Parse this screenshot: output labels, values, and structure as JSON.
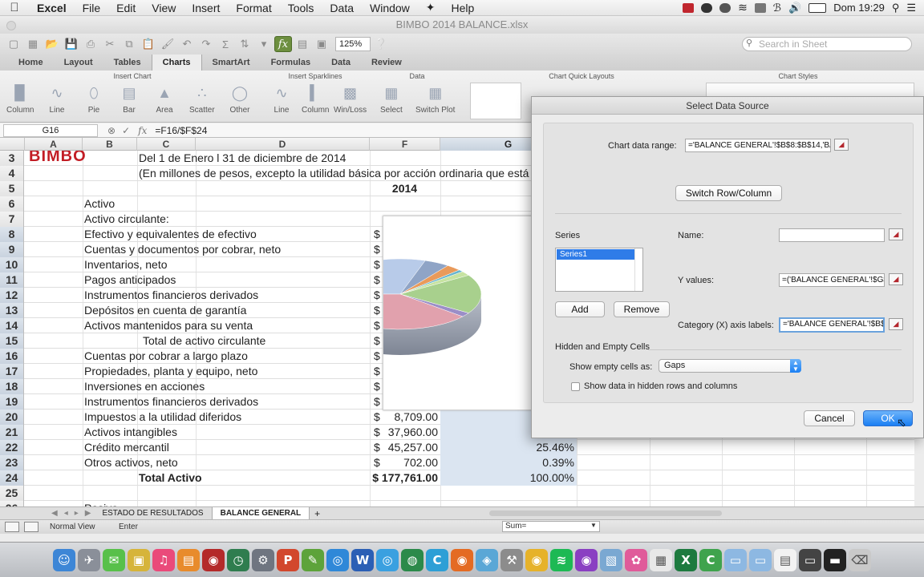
{
  "menubar": {
    "app": "Excel",
    "items": [
      "File",
      "Edit",
      "View",
      "Insert",
      "Format",
      "Tools",
      "Data",
      "Window",
      "Help"
    ],
    "clock": "Dom 19:29"
  },
  "window": {
    "title": "BIMBO 2014 BALANCE.xlsx"
  },
  "toolbar": {
    "zoom": "125%",
    "search_placeholder": "Search in Sheet"
  },
  "ribbon": {
    "tabs": [
      "Home",
      "Layout",
      "Tables",
      "Charts",
      "SmartArt",
      "Formulas",
      "Data",
      "Review"
    ],
    "active_tab": "Charts",
    "groups": {
      "insert_chart": "Insert Chart",
      "insert_sparklines": "Insert Sparklines",
      "data": "Data",
      "quick_layouts": "Chart Quick Layouts",
      "chart_styles": "Chart Styles"
    },
    "chart_buttons": [
      "Column",
      "Line",
      "Pie",
      "Bar",
      "Area",
      "Scatter",
      "Other"
    ],
    "sparkline_buttons": [
      "Line",
      "Column",
      "Win/Loss"
    ],
    "data_buttons": [
      "Select",
      "Switch Plot"
    ]
  },
  "formula_bar": {
    "cell": "G16",
    "fx": "fx",
    "formula": "=F16/$F$24"
  },
  "columns": [
    "A",
    "B",
    "C",
    "D",
    "F",
    "G"
  ],
  "rows": [
    {
      "n": "3",
      "b": "",
      "c": "Del 1 de Enero l 31 de diciembre de 2014",
      "f": "",
      "g": ""
    },
    {
      "n": "4",
      "b": "",
      "c": "(En millones de pesos, excepto la utilidad básica por acción ordinaria que está expres",
      "f": "",
      "g": ""
    },
    {
      "n": "5",
      "b": "",
      "c": "",
      "f": "2014",
      "g": ""
    },
    {
      "n": "6",
      "b": "Activo",
      "c": "",
      "f": "",
      "g": ""
    },
    {
      "n": "7",
      "b": "Activo circulante:",
      "c": "",
      "f": "",
      "g": ""
    },
    {
      "n": "8",
      "b": " Efectivo y equivalentes de efectivo",
      "c": "",
      "f": "$",
      "g": ""
    },
    {
      "n": "9",
      "b": " Cuentas y documentos por cobrar, neto",
      "c": "",
      "f": "$",
      "g": ""
    },
    {
      "n": "10",
      "b": " Inventarios, neto",
      "c": "",
      "f": "$",
      "g": ""
    },
    {
      "n": "11",
      "b": " Pagos anticipados",
      "c": "",
      "f": "$",
      "g": ""
    },
    {
      "n": "12",
      "b": " Instrumentos financieros derivados",
      "c": "",
      "f": "$",
      "g": ""
    },
    {
      "n": "13",
      "b": " Depósitos en cuenta de garantía",
      "c": "",
      "f": "$",
      "g": ""
    },
    {
      "n": "14",
      "b": " Activos mantenidos para su venta",
      "c": "",
      "f": "$",
      "g": ""
    },
    {
      "n": "15",
      "b": "",
      "c": "Total de activo circulante",
      "f": "$",
      "g": ""
    },
    {
      "n": "16",
      "b": " Cuentas por cobrar a largo plazo",
      "c": "",
      "f": "$",
      "g": ""
    },
    {
      "n": "17",
      "b": " Propiedades, planta y equipo, neto",
      "c": "",
      "f": "$",
      "g": ""
    },
    {
      "n": "18",
      "b": " Inversiones en acciones",
      "c": "",
      "f": "$",
      "g": ""
    },
    {
      "n": "19",
      "b": " Instrumentos financieros derivados",
      "c": "",
      "f": "$",
      "g": ""
    },
    {
      "n": "20",
      "b": " Impuestos a la utilidad diferidos",
      "c": "",
      "f": "$",
      "fv": "8,709.00",
      "g": ""
    },
    {
      "n": "21",
      "b": " Activos intangibles",
      "c": "",
      "f": "$",
      "fv": "37,960.00",
      "g": ""
    },
    {
      "n": "22",
      "b": " Crédito mercantil",
      "c": "",
      "f": "$",
      "fv": "45,257.00",
      "g": "25.46%"
    },
    {
      "n": "23",
      "b": " Otros activos, neto",
      "c": "",
      "f": "$",
      "fv": "702.00",
      "g": "0.39%"
    },
    {
      "n": "24",
      "b": "",
      "c": "Total Activo",
      "f": "$ 177,761.00",
      "g": "100.00%"
    },
    {
      "n": "25",
      "b": "",
      "c": "",
      "f": "",
      "g": ""
    },
    {
      "n": "26",
      "b": "Pasivo",
      "c": "",
      "f": "",
      "g": ""
    }
  ],
  "logo_text": "BIMBO",
  "sheet_tabs": [
    "ESTADO DE RESULTADOS",
    "BALANCE GENERAL"
  ],
  "active_sheet": "BALANCE GENERAL",
  "status": {
    "view": "Normal View",
    "mode": "Enter",
    "sum": "Sum="
  },
  "dialog": {
    "title": "Select Data Source",
    "chart_range_label": "Chart data range:",
    "chart_range_value": "='BALANCE GENERAL'!$B$8:$B$14,'BA",
    "switch_button": "Switch Row/Column",
    "series_label": "Series",
    "series_items": [
      "Series1"
    ],
    "name_label": "Name:",
    "name_value": "",
    "y_values_label": "Y values:",
    "y_values_value": "=('BALANCE GENERAL'!$G$",
    "category_label": "Category (X) axis labels:",
    "category_value": "='BALANCE GENERAL'!$B$8",
    "add_button": "Add",
    "remove_button": "Remove",
    "hidden_empty_label": "Hidden and Empty Cells",
    "show_empty_label": "Show empty cells as:",
    "show_empty_value": "Gaps",
    "hidden_rows_label": "Show data in hidden rows and columns",
    "cancel_button": "Cancel",
    "ok_button": "OK"
  },
  "colors": {
    "selection": "#dbe5f1",
    "primary_button": "#1b7ff3",
    "active_tab": "#ececec",
    "pie": [
      "#b8cbe9",
      "#8fa4c6",
      "#e99a5a",
      "#67b6cf",
      "#c7e3a1",
      "#a8d08d",
      "#9b8ec7",
      "#e1a1ad"
    ]
  },
  "dock_icons": [
    "finder-icon",
    "launchpad-icon",
    "messages-icon",
    "notes-icon",
    "itunes-icon",
    "ibooks-icon",
    "photobooth-icon",
    "time-machine-icon",
    "system-prefs-icon",
    "powerpoint-icon",
    "evernote-icon",
    "safari-icon",
    "word-icon",
    "safari2-icon",
    "earth-icon",
    "cashier-icon",
    "firefox-icon",
    "maps-icon",
    "tools-icon",
    "chrome-icon",
    "spotify-icon",
    "podcasts-icon",
    "preview-icon",
    "photos-icon",
    "calendar-icon",
    "excel-icon",
    "camtasia-icon",
    "folder-icon",
    "folder2-icon",
    "doc-icon",
    "display-icon",
    "terminal-icon",
    "trash-icon"
  ]
}
